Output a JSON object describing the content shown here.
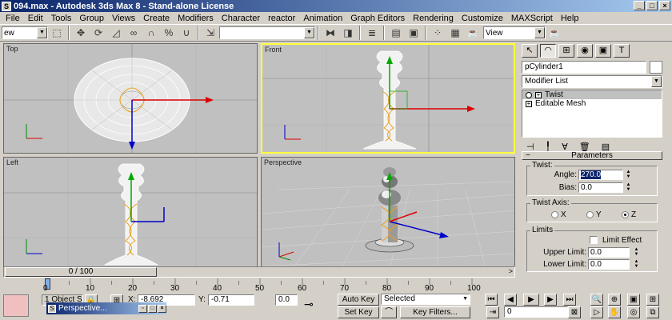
{
  "window": {
    "title": "094.max - Autodesk 3ds Max 8  - Stand-alone License",
    "app_icon": "3ds-max-icon",
    "controls": [
      "_",
      "□",
      "×"
    ]
  },
  "menu": [
    "File",
    "Edit",
    "Tools",
    "Group",
    "Views",
    "Create",
    "Modifiers",
    "Character",
    "reactor",
    "Animation",
    "Graph Editors",
    "Rendering",
    "Customize",
    "MAXScript",
    "Help"
  ],
  "toolbar": {
    "selection_filter": "ew",
    "named_selection": "",
    "ref_coord": "View",
    "icons": [
      "select-icon",
      "move-icon",
      "rotate-icon",
      "scale-icon",
      "link-icon",
      "unlink-icon",
      "bind-icon",
      "snap-icon",
      "angle-snap-icon",
      "percent-snap-icon",
      "spinner-snap-icon",
      "edit-named-icon",
      "mirror-icon",
      "align-icon",
      "layer-icon",
      "curve-editor-icon",
      "schematic-icon",
      "material-editor-icon",
      "render-scene-icon",
      "quick-render-icon"
    ]
  },
  "viewports": {
    "top": {
      "label": "Top"
    },
    "front": {
      "label": "Front"
    },
    "left": {
      "label": "Left"
    },
    "perspective": {
      "label": "Perspective"
    },
    "axis": {
      "x": "x",
      "y": "y",
      "z": "z"
    }
  },
  "command_panel": {
    "object_name": "pCylinder1",
    "object_color": "#ffffff",
    "modifier_list": "Modifier List",
    "stack": [
      {
        "label": "Twist",
        "selected": true
      },
      {
        "label": "Editable Mesh",
        "selected": false
      }
    ],
    "parameters": {
      "header": "Parameters",
      "twist_group": "Twist:",
      "angle_label": "Angle:",
      "angle_value": "270.0",
      "bias_label": "Bias:",
      "bias_value": "0.0",
      "axis_group": "Twist Axis:",
      "axis_options": [
        "X",
        "Y",
        "Z"
      ],
      "axis_selected": "Z",
      "limits_group": "Limits",
      "limit_effect_label": "Limit Effect",
      "upper_label": "Upper Limit:",
      "upper_value": "0.0",
      "lower_label": "Lower Limit:",
      "lower_value": "0.0"
    }
  },
  "timeline": {
    "slider": "0 / 100",
    "ticks": [
      "0",
      "10",
      "20",
      "30",
      "40",
      "50",
      "60",
      "70",
      "80",
      "90",
      "100"
    ]
  },
  "status": {
    "selection": "1 Object S",
    "x_label": "X:",
    "x_value": "-8.692",
    "y_label": "Y:",
    "y_value": "-0.71",
    "z_value": "0.0",
    "auto_key": "Auto Key",
    "set_key": "Set Key",
    "key_mode": "Selected",
    "key_filters": "Key Filters...",
    "frame": "0",
    "taskbar": "Perspective..."
  }
}
